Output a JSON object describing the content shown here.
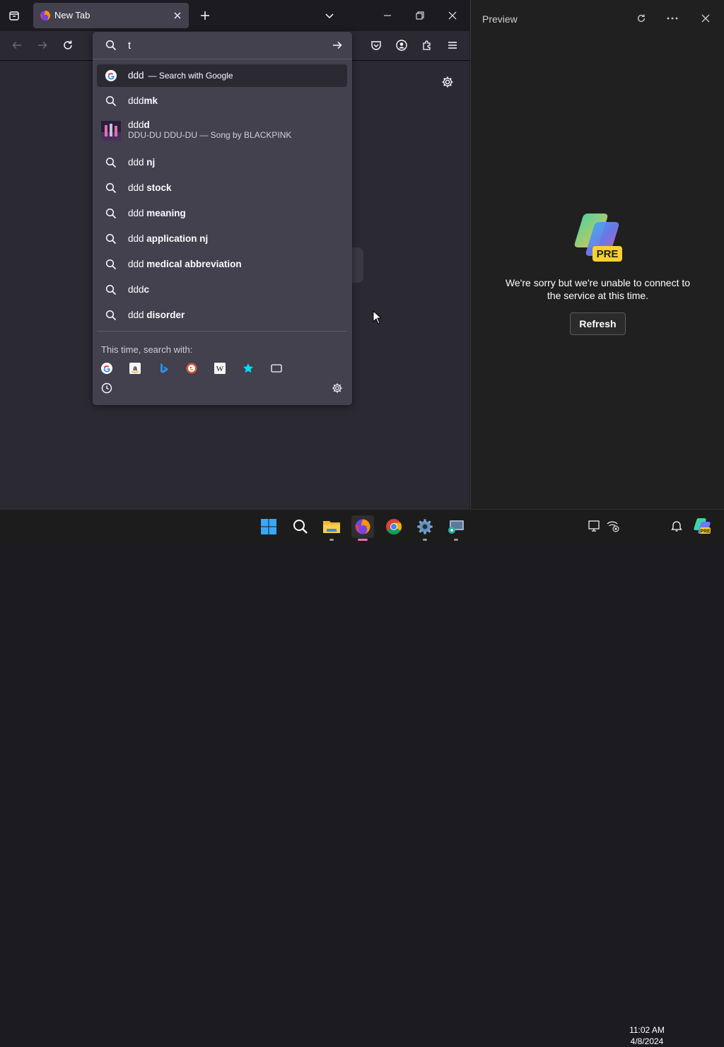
{
  "browser": {
    "tab": {
      "title": "New Tab"
    },
    "urlbar": {
      "value": "t",
      "results": [
        {
          "kind": "search-engine",
          "typed": "ddd",
          "bold": "",
          "suffix": "— Search with Google",
          "selected": true,
          "icon": "google-icon"
        },
        {
          "kind": "suggestion",
          "typed": "ddd",
          "bold": "mk",
          "icon": "search-icon"
        },
        {
          "kind": "song",
          "typed": "ddd",
          "bold": "d",
          "subtitle": "DDU-DU DDU-DU — Song by BLACKPINK",
          "icon": "album-thumbnail"
        },
        {
          "kind": "suggestion",
          "typed": "ddd ",
          "bold": "nj",
          "icon": "search-icon"
        },
        {
          "kind": "suggestion",
          "typed": "ddd ",
          "bold": "stock",
          "icon": "search-icon"
        },
        {
          "kind": "suggestion",
          "typed": "ddd ",
          "bold": "meaning",
          "icon": "search-icon"
        },
        {
          "kind": "suggestion",
          "typed": "ddd ",
          "bold": "application nj",
          "icon": "search-icon"
        },
        {
          "kind": "suggestion",
          "typed": "ddd ",
          "bold": "medical abbreviation",
          "icon": "search-icon"
        },
        {
          "kind": "suggestion",
          "typed": "ddd",
          "bold": "c",
          "icon": "search-icon"
        },
        {
          "kind": "suggestion",
          "typed": "ddd ",
          "bold": "disorder",
          "icon": "search-icon"
        }
      ],
      "oneoff_label": "This time, search with:",
      "engines": [
        "google-icon",
        "amazon-icon",
        "bing-icon",
        "duckduckgo-icon",
        "wikipedia-icon",
        "bookmarks-star-icon",
        "tabs-icon"
      ]
    }
  },
  "preview": {
    "title": "Preview",
    "message": "We're sorry but we're unable to connect to the service at this time.",
    "refresh_label": "Refresh",
    "badge": "PRE"
  },
  "taskbar": {
    "time": "11:02 AM",
    "date": "4/8/2024",
    "apps": [
      "windows-start-icon",
      "search-icon",
      "file-explorer-icon",
      "firefox-icon",
      "chrome-icon",
      "settings-icon",
      "remote-desktop-icon"
    ]
  },
  "colors": {
    "accent": "#e96fb0",
    "panel": "#42414d",
    "selection": "#2b2a33"
  }
}
